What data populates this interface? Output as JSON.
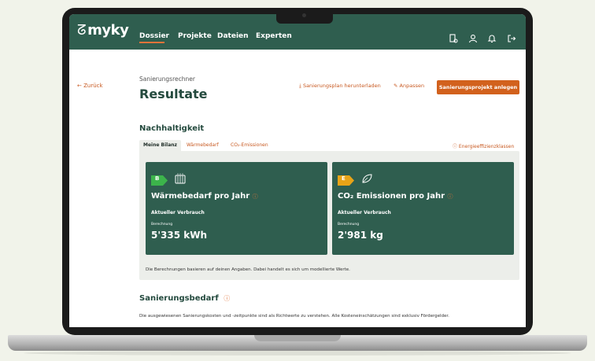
{
  "nav": {
    "logo": "myky",
    "items": [
      "Dossier",
      "Projekte",
      "Dateien",
      "Experten"
    ],
    "active": "Dossier",
    "icons": [
      "document-settings-icon",
      "user-icon",
      "bell-icon",
      "logout-icon"
    ]
  },
  "header": {
    "back": "← Zurück",
    "breadcrumb": "Sanierungsrechner",
    "title": "Resultate",
    "download": "Sanierungsplan herunterladen",
    "edit": "Anpassen",
    "primary": "Sanierungsprojekt anlegen"
  },
  "sustainability": {
    "heading": "Nachhaltigkeit",
    "tabs": [
      "Meine Bilanz",
      "Wärmebedarf",
      "CO₂-Emissionen"
    ],
    "info_link": "Energieeffizienzklassen",
    "cards": [
      {
        "badge": "B",
        "badge_color": "#3cb44b",
        "icon": "heater-icon",
        "title": "Wärmebedarf pro Jahr",
        "subtitle": "Aktueller Verbrauch",
        "calc_label": "Berechnung",
        "value": "5'335 kWh"
      },
      {
        "badge": "E",
        "badge_color": "#e8a317",
        "icon": "leaf-icon",
        "title": "CO₂ Emissionen pro Jahr",
        "subtitle": "Aktueller Verbrauch",
        "calc_label": "Berechnung",
        "value": "2'981 kg"
      }
    ],
    "note": "Die Berechnungen basieren auf deinen Angaben. Dabei handelt es sich um modellierte Werte."
  },
  "renovation": {
    "heading": "Sanierungsbedarf",
    "text": "Die ausgewiesenen Sanierungskosten und -zeitpunkte sind als Richtwerte zu verstehen. Alle Kosteneinschätzungen sind exklusiv Fördergelder."
  },
  "colors": {
    "brand_green": "#2f5e4f",
    "accent_orange": "#d2611d"
  }
}
